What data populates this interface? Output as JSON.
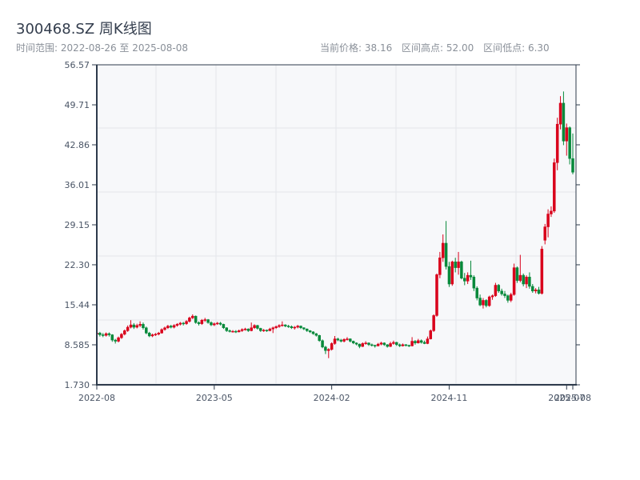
{
  "header": {
    "title": "300468.SZ 周K线图",
    "range_text": "时间范围: 2022-08-26 至 2025-08-08",
    "current_price": "当前价格: 38.16",
    "range_high": "区间高点: 52.00",
    "range_low": "区间低点: 6.30"
  },
  "chart_data": {
    "type": "candlestick",
    "title": "300468.SZ 周K线图",
    "frequency": "weekly",
    "start_date": "2022-08-26",
    "end_date": "2025-08-08",
    "ylim": [
      1.73,
      56.57
    ],
    "y_ticks": [
      "1.730",
      "8.585",
      "15.44",
      "22.30",
      "29.15",
      "36.01",
      "42.86",
      "49.71",
      "56.57"
    ],
    "x_ticks": [
      "2022-08",
      "2023-05",
      "2024-02",
      "2024-11",
      "2025-07",
      "2025-08"
    ],
    "grid": true,
    "colors": {
      "up": "#d9001b",
      "down": "#07893a",
      "axis": "#2d3a4b",
      "plot_bg": "#f7f8fa",
      "grid": "#e3e6ea"
    },
    "candle_fields": [
      "open",
      "high",
      "low",
      "close"
    ],
    "candles": [
      [
        10.4,
        10.9,
        10.1,
        10.6
      ],
      [
        10.6,
        10.8,
        10.0,
        10.3
      ],
      [
        10.3,
        10.6,
        9.9,
        10.2
      ],
      [
        10.2,
        10.7,
        10.0,
        10.5
      ],
      [
        10.5,
        10.7,
        10.0,
        10.3
      ],
      [
        10.3,
        10.4,
        9.1,
        9.4
      ],
      [
        9.4,
        9.6,
        8.8,
        9.2
      ],
      [
        9.2,
        10.0,
        9.0,
        9.8
      ],
      [
        9.8,
        10.6,
        9.6,
        10.4
      ],
      [
        10.4,
        11.2,
        10.2,
        11.0
      ],
      [
        11.0,
        11.9,
        10.8,
        11.6
      ],
      [
        11.6,
        12.8,
        11.4,
        12.0
      ],
      [
        12.0,
        12.3,
        11.3,
        11.6
      ],
      [
        11.6,
        12.2,
        11.4,
        11.9
      ],
      [
        11.9,
        12.6,
        11.6,
        12.1
      ],
      [
        12.1,
        12.4,
        11.2,
        11.5
      ],
      [
        11.5,
        11.7,
        10.4,
        10.6
      ],
      [
        10.6,
        10.8,
        9.9,
        10.1
      ],
      [
        10.1,
        10.5,
        9.9,
        10.3
      ],
      [
        10.3,
        10.6,
        10.1,
        10.4
      ],
      [
        10.4,
        10.8,
        10.2,
        10.6
      ],
      [
        10.6,
        11.4,
        10.5,
        11.2
      ],
      [
        11.2,
        11.7,
        11.0,
        11.5
      ],
      [
        11.5,
        12.0,
        11.3,
        11.8
      ],
      [
        11.8,
        12.0,
        11.4,
        11.6
      ],
      [
        11.6,
        12.1,
        11.4,
        11.9
      ],
      [
        11.9,
        12.3,
        11.7,
        12.1
      ],
      [
        12.1,
        12.5,
        11.9,
        12.3
      ],
      [
        12.3,
        12.5,
        11.9,
        12.2
      ],
      [
        12.2,
        12.8,
        12.0,
        12.6
      ],
      [
        12.6,
        13.4,
        12.4,
        13.2
      ],
      [
        13.2,
        13.8,
        13.0,
        13.5
      ],
      [
        13.5,
        13.6,
        12.2,
        12.4
      ],
      [
        12.4,
        12.6,
        11.9,
        12.2
      ],
      [
        12.2,
        13.0,
        12.0,
        12.8
      ],
      [
        12.8,
        13.2,
        12.5,
        12.9
      ],
      [
        12.9,
        13.0,
        12.2,
        12.4
      ],
      [
        12.4,
        12.6,
        11.8,
        12.0
      ],
      [
        12.0,
        12.4,
        11.8,
        12.2
      ],
      [
        12.2,
        12.5,
        12.0,
        12.3
      ],
      [
        12.3,
        12.5,
        11.9,
        12.1
      ],
      [
        12.1,
        12.2,
        11.3,
        11.5
      ],
      [
        11.5,
        11.6,
        10.8,
        11.0
      ],
      [
        11.0,
        11.2,
        10.7,
        10.9
      ],
      [
        10.9,
        11.1,
        10.7,
        10.9
      ],
      [
        10.9,
        11.1,
        10.6,
        10.8
      ],
      [
        10.8,
        11.2,
        10.7,
        11.0
      ],
      [
        11.0,
        11.4,
        10.8,
        11.2
      ],
      [
        11.2,
        11.5,
        11.0,
        11.3
      ],
      [
        11.3,
        11.4,
        10.8,
        11.0
      ],
      [
        11.0,
        12.4,
        10.9,
        11.5
      ],
      [
        11.5,
        12.1,
        11.3,
        11.9
      ],
      [
        11.9,
        12.0,
        11.2,
        11.4
      ],
      [
        11.4,
        11.5,
        10.8,
        11.0
      ],
      [
        11.0,
        11.3,
        10.8,
        11.1
      ],
      [
        11.1,
        11.2,
        10.8,
        11.0
      ],
      [
        11.0,
        11.5,
        10.9,
        11.3
      ],
      [
        11.3,
        11.7,
        10.6,
        11.5
      ],
      [
        11.5,
        11.9,
        11.3,
        11.7
      ],
      [
        11.7,
        12.1,
        11.5,
        11.9
      ],
      [
        11.9,
        12.6,
        11.7,
        12.0
      ],
      [
        12.0,
        12.1,
        11.6,
        11.8
      ],
      [
        11.8,
        12.0,
        11.5,
        11.7
      ],
      [
        11.7,
        11.9,
        11.3,
        11.5
      ],
      [
        11.5,
        11.8,
        11.2,
        11.6
      ],
      [
        11.6,
        12.0,
        11.4,
        11.8
      ],
      [
        11.8,
        11.9,
        11.3,
        11.5
      ],
      [
        11.5,
        11.6,
        11.1,
        11.3
      ],
      [
        11.3,
        11.4,
        10.8,
        11.0
      ],
      [
        11.0,
        11.1,
        10.6,
        10.8
      ],
      [
        10.8,
        10.9,
        10.3,
        10.5
      ],
      [
        10.5,
        10.6,
        10.0,
        10.2
      ],
      [
        10.2,
        10.3,
        9.1,
        9.3
      ],
      [
        9.3,
        9.5,
        8.0,
        8.2
      ],
      [
        8.2,
        8.4,
        7.0,
        7.6
      ],
      [
        7.6,
        8.0,
        6.3,
        7.8
      ],
      [
        7.8,
        9.0,
        7.6,
        8.8
      ],
      [
        8.8,
        10.1,
        8.6,
        9.6
      ],
      [
        9.6,
        9.8,
        9.2,
        9.4
      ],
      [
        9.4,
        9.6,
        9.0,
        9.2
      ],
      [
        9.2,
        9.7,
        9.0,
        9.5
      ],
      [
        9.5,
        9.9,
        9.3,
        9.6
      ],
      [
        9.6,
        9.7,
        9.0,
        9.2
      ],
      [
        9.2,
        9.3,
        8.7,
        8.9
      ],
      [
        8.9,
        9.0,
        8.5,
        8.7
      ],
      [
        8.7,
        8.8,
        8.0,
        8.3
      ],
      [
        8.3,
        9.0,
        8.2,
        8.8
      ],
      [
        8.8,
        9.2,
        8.6,
        8.9
      ],
      [
        8.9,
        9.0,
        8.4,
        8.6
      ],
      [
        8.6,
        8.8,
        8.3,
        8.5
      ],
      [
        8.5,
        8.6,
        8.1,
        8.4
      ],
      [
        8.4,
        8.9,
        8.3,
        8.7
      ],
      [
        8.7,
        9.1,
        8.5,
        8.9
      ],
      [
        8.9,
        9.0,
        8.4,
        8.6
      ],
      [
        8.6,
        8.7,
        8.1,
        8.3
      ],
      [
        8.3,
        9.1,
        8.2,
        8.8
      ],
      [
        8.8,
        9.3,
        8.6,
        9.0
      ],
      [
        9.0,
        9.1,
        8.4,
        8.6
      ],
      [
        8.6,
        8.8,
        8.2,
        8.4
      ],
      [
        8.4,
        8.8,
        8.3,
        8.6
      ],
      [
        8.6,
        8.7,
        8.3,
        8.5
      ],
      [
        8.5,
        8.6,
        8.2,
        8.4
      ],
      [
        8.4,
        9.9,
        8.3,
        9.2
      ],
      [
        9.2,
        9.4,
        8.6,
        8.9
      ],
      [
        8.9,
        9.6,
        8.8,
        9.3
      ],
      [
        9.3,
        9.5,
        8.8,
        9.0
      ],
      [
        9.0,
        9.3,
        8.7,
        8.8
      ],
      [
        8.8,
        10.0,
        8.7,
        9.6
      ],
      [
        9.6,
        11.2,
        9.5,
        11.0
      ],
      [
        11.0,
        13.8,
        10.8,
        13.6
      ],
      [
        13.6,
        20.8,
        13.4,
        20.6
      ],
      [
        20.6,
        24.5,
        20.0,
        23.5
      ],
      [
        23.5,
        27.5,
        22.8,
        26.0
      ],
      [
        26.0,
        29.8,
        21.5,
        22.0
      ],
      [
        22.0,
        22.8,
        18.5,
        19.0
      ],
      [
        19.0,
        23.0,
        18.7,
        22.8
      ],
      [
        22.8,
        23.5,
        21.0,
        21.8
      ],
      [
        21.8,
        24.5,
        20.6,
        22.8
      ],
      [
        22.8,
        23.0,
        19.8,
        20.0
      ],
      [
        20.0,
        20.9,
        18.8,
        19.5
      ],
      [
        19.5,
        21.0,
        19.0,
        20.5
      ],
      [
        20.5,
        23.0,
        19.7,
        20.2
      ],
      [
        20.2,
        20.5,
        17.8,
        18.3
      ],
      [
        18.3,
        18.6,
        16.2,
        16.6
      ],
      [
        16.6,
        17.2,
        15.2,
        15.4
      ],
      [
        15.4,
        16.6,
        14.8,
        16.2
      ],
      [
        16.2,
        16.4,
        15.0,
        15.3
      ],
      [
        15.3,
        17.0,
        15.1,
        16.8
      ],
      [
        16.8,
        17.2,
        16.3,
        17.0
      ],
      [
        17.0,
        19.2,
        16.8,
        18.8
      ],
      [
        18.8,
        19.0,
        17.5,
        17.8
      ],
      [
        17.8,
        18.2,
        17.0,
        17.3
      ],
      [
        17.3,
        17.8,
        16.6,
        17.0
      ],
      [
        17.0,
        17.2,
        15.8,
        16.2
      ],
      [
        16.2,
        17.5,
        15.9,
        17.2
      ],
      [
        17.2,
        22.5,
        17.0,
        21.8
      ],
      [
        21.8,
        22.0,
        19.2,
        19.6
      ],
      [
        19.6,
        24.0,
        19.3,
        20.5
      ],
      [
        20.5,
        20.8,
        18.6,
        19.0
      ],
      [
        19.0,
        20.5,
        18.3,
        20.2
      ],
      [
        20.2,
        21.0,
        18.2,
        18.6
      ],
      [
        18.6,
        19.0,
        17.5,
        17.8
      ],
      [
        17.8,
        18.3,
        17.4,
        18.0
      ],
      [
        18.0,
        18.5,
        17.2,
        17.4
      ],
      [
        17.4,
        25.5,
        17.2,
        25.0
      ],
      [
        26.5,
        29.3,
        25.8,
        28.8
      ],
      [
        28.8,
        31.8,
        27.0,
        31.0
      ],
      [
        31.0,
        32.3,
        30.5,
        31.5
      ],
      [
        31.5,
        40.5,
        31.2,
        39.8
      ],
      [
        39.8,
        47.5,
        38.5,
        46.4
      ],
      [
        46.4,
        51.2,
        45.5,
        50.0
      ],
      [
        50.0,
        52.0,
        42.8,
        43.5
      ],
      [
        43.5,
        46.5,
        41.0,
        45.8
      ],
      [
        45.8,
        46.0,
        39.5,
        40.5
      ],
      [
        40.5,
        44.8,
        37.8,
        38.16
      ]
    ]
  }
}
